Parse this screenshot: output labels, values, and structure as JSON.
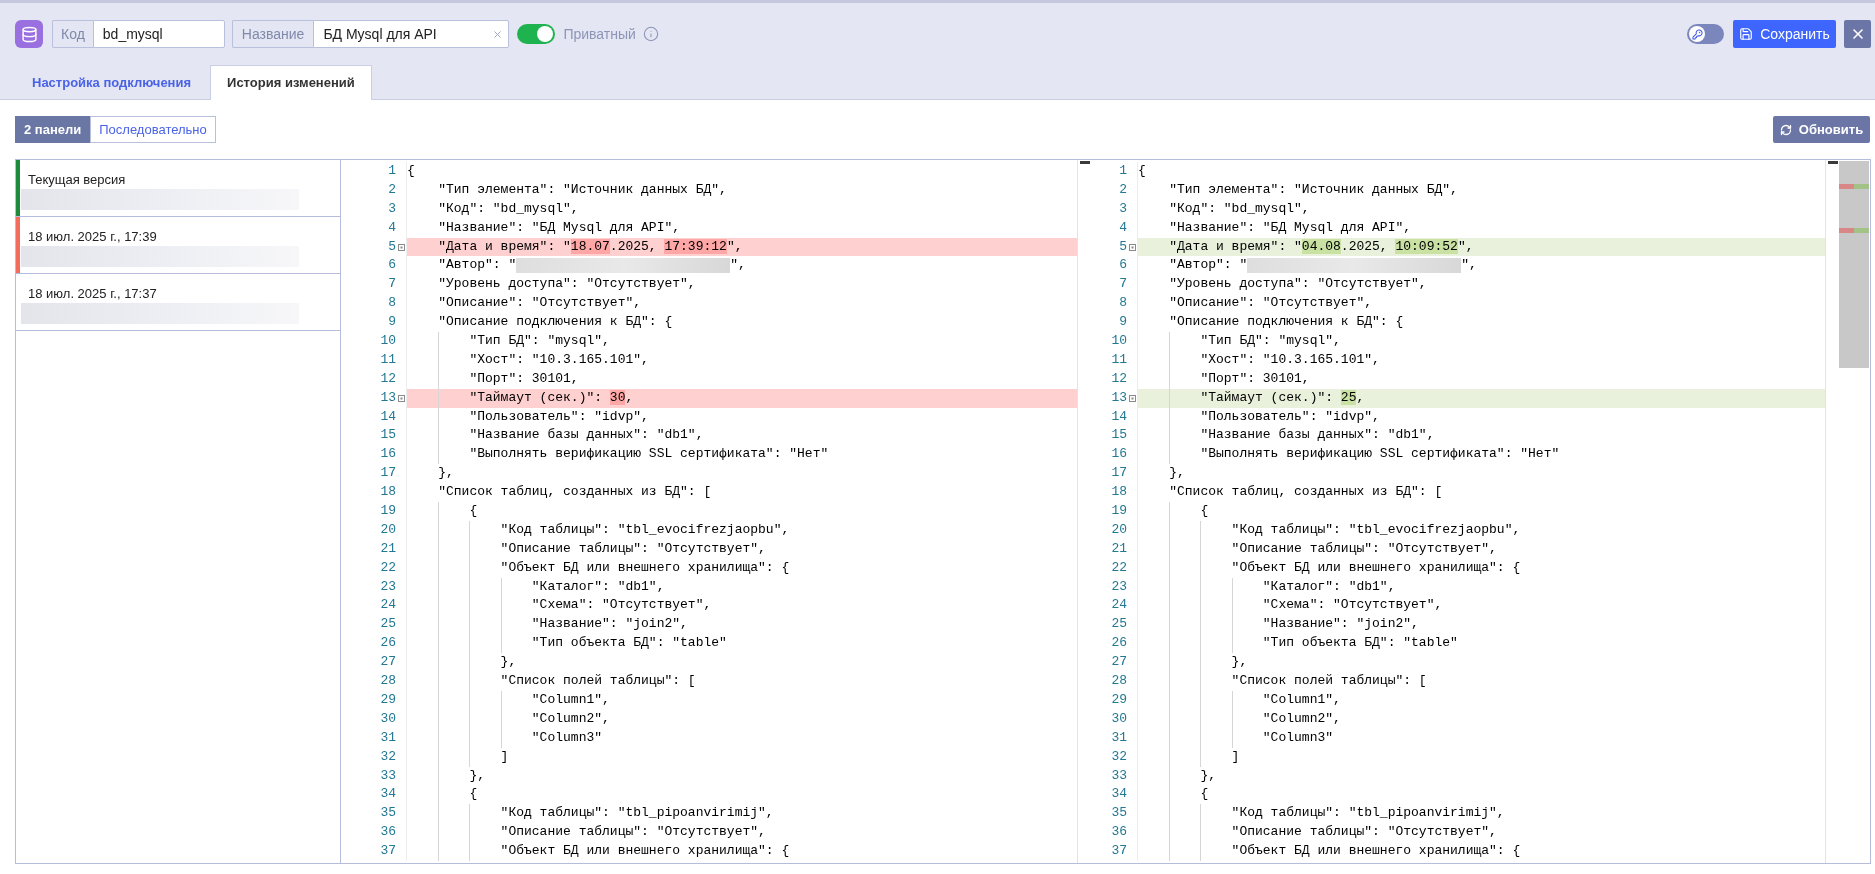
{
  "header": {
    "code_field": {
      "label": "Код",
      "value": "bd_mysql"
    },
    "name_field": {
      "label": "Название",
      "value": "БД Mysql для API"
    },
    "private_toggle": {
      "label": "Приватный",
      "on": true
    },
    "key_toggle": {
      "on": false
    },
    "save_button": "Сохранить"
  },
  "tabs": [
    {
      "label": "Настройка подключения",
      "selected": false
    },
    {
      "label": "История изменений",
      "selected": true
    }
  ],
  "toolbar": {
    "view_modes": [
      {
        "label": "2 панели",
        "selected": true
      },
      {
        "label": "Последовательно",
        "selected": false
      }
    ],
    "refresh_button": "Обновить"
  },
  "versions": [
    {
      "title": "Текущая версия",
      "color": "#1e8a3c"
    },
    {
      "title": "18 июл. 2025 г., 17:39",
      "color": "#f46c5c"
    },
    {
      "title": "18 июл. 2025 г., 17:37"
    }
  ],
  "diff": {
    "left": {
      "lines": [
        {
          "number": "1",
          "changed": false,
          "text": "{"
        },
        {
          "number": "2",
          "changed": false,
          "text": "    \"Тип элемента\": \"Источник данных БД\","
        },
        {
          "number": "3",
          "changed": false,
          "text": "    \"Код\": \"bd_mysql\","
        },
        {
          "number": "4",
          "changed": false,
          "text": "    \"Название\": \"БД Mysql для API\","
        },
        {
          "number": "5",
          "changed": true,
          "segments": [
            {
              "kind": "code",
              "text": "    \"Дата и время\": \""
            },
            {
              "kind": "diff",
              "text": "18.07"
            },
            {
              "kind": "code",
              "text": ".2025, "
            },
            {
              "kind": "diff",
              "text": "17:39:12"
            },
            {
              "kind": "code",
              "text": "\","
            }
          ]
        },
        {
          "number": "6",
          "changed": false,
          "segments": [
            {
              "kind": "code",
              "text": "    \"Автор\": \""
            },
            {
              "kind": "blurred"
            },
            {
              "kind": "code",
              "text": "\","
            }
          ]
        },
        {
          "number": "7",
          "changed": false,
          "text": "    \"Уровень доступа\": \"Отсутствует\","
        },
        {
          "number": "8",
          "changed": false,
          "text": "    \"Описание\": \"Отсутствует\","
        },
        {
          "number": "9",
          "changed": false,
          "text": "    \"Описание подключения к БД\": {"
        },
        {
          "number": "10",
          "changed": false,
          "text": "        \"Тип БД\": \"mysql\","
        },
        {
          "number": "11",
          "changed": false,
          "text": "        \"Хост\": \"10.3.165.101\","
        },
        {
          "number": "12",
          "changed": false,
          "text": "        \"Порт\": 30101,"
        },
        {
          "number": "13",
          "changed": true,
          "segments": [
            {
              "kind": "code",
              "text": "        \"Таймаут (сек.)\": "
            },
            {
              "kind": "diff",
              "text": "30"
            },
            {
              "kind": "code",
              "text": ","
            }
          ]
        },
        {
          "number": "14",
          "changed": false,
          "text": "        \"Пользователь\": \"idvp\","
        },
        {
          "number": "15",
          "changed": false,
          "text": "        \"Название базы данных\": \"db1\","
        },
        {
          "number": "16",
          "changed": false,
          "text": "        \"Выполнять верификацию SSL сертификата\": \"Нет\""
        },
        {
          "number": "17",
          "changed": false,
          "text": "    },"
        },
        {
          "number": "18",
          "changed": false,
          "text": "    \"Список таблиц, созданных из БД\": ["
        },
        {
          "number": "19",
          "changed": false,
          "text": "        {"
        },
        {
          "number": "20",
          "changed": false,
          "text": "            \"Код таблицы\": \"tbl_evocifrezjaopbu\","
        },
        {
          "number": "21",
          "changed": false,
          "text": "            \"Описание таблицы\": \"Отсутствует\","
        },
        {
          "number": "22",
          "changed": false,
          "text": "            \"Объект БД или внешнего хранилища\": {"
        },
        {
          "number": "23",
          "changed": false,
          "text": "                \"Каталог\": \"db1\","
        },
        {
          "number": "24",
          "changed": false,
          "text": "                \"Схема\": \"Отсутствует\","
        },
        {
          "number": "25",
          "changed": false,
          "text": "                \"Название\": \"join2\","
        },
        {
          "number": "26",
          "changed": false,
          "text": "                \"Тип объекта БД\": \"table\""
        },
        {
          "number": "27",
          "changed": false,
          "text": "            },"
        },
        {
          "number": "28",
          "changed": false,
          "text": "            \"Список полей таблицы\": ["
        },
        {
          "number": "29",
          "changed": false,
          "text": "                \"Column1\","
        },
        {
          "number": "30",
          "changed": false,
          "text": "                \"Column2\","
        },
        {
          "number": "31",
          "changed": false,
          "text": "                \"Column3\""
        },
        {
          "number": "32",
          "changed": false,
          "text": "            ]"
        },
        {
          "number": "33",
          "changed": false,
          "text": "        },"
        },
        {
          "number": "34",
          "changed": false,
          "text": "        {"
        },
        {
          "number": "35",
          "changed": false,
          "text": "            \"Код таблицы\": \"tbl_pipoanvirimij\","
        },
        {
          "number": "36",
          "changed": false,
          "text": "            \"Описание таблицы\": \"Отсутствует\","
        },
        {
          "number": "37",
          "changed": false,
          "text": "            \"Объект БД или внешнего хранилища\": {"
        }
      ]
    },
    "right": {
      "lines": [
        {
          "number": "1",
          "changed": false,
          "text": "{"
        },
        {
          "number": "2",
          "changed": false,
          "text": "    \"Тип элемента\": \"Источник данных БД\","
        },
        {
          "number": "3",
          "changed": false,
          "text": "    \"Код\": \"bd_mysql\","
        },
        {
          "number": "4",
          "changed": false,
          "text": "    \"Название\": \"БД Mysql для API\","
        },
        {
          "number": "5",
          "changed": true,
          "segments": [
            {
              "kind": "code",
              "text": "    \"Дата и время\": \""
            },
            {
              "kind": "diff",
              "text": "04.08"
            },
            {
              "kind": "code",
              "text": ".2025, "
            },
            {
              "kind": "diff",
              "text": "10:09:52"
            },
            {
              "kind": "code",
              "text": "\","
            }
          ]
        },
        {
          "number": "6",
          "changed": false,
          "segments": [
            {
              "kind": "code",
              "text": "    \"Автор\": \""
            },
            {
              "kind": "blurred"
            },
            {
              "kind": "code",
              "text": "\","
            }
          ]
        },
        {
          "number": "7",
          "changed": false,
          "text": "    \"Уровень доступа\": \"Отсутствует\","
        },
        {
          "number": "8",
          "changed": false,
          "text": "    \"Описание\": \"Отсутствует\","
        },
        {
          "number": "9",
          "changed": false,
          "text": "    \"Описание подключения к БД\": {"
        },
        {
          "number": "10",
          "changed": false,
          "text": "        \"Тип БД\": \"mysql\","
        },
        {
          "number": "11",
          "changed": false,
          "text": "        \"Хост\": \"10.3.165.101\","
        },
        {
          "number": "12",
          "changed": false,
          "text": "        \"Порт\": 30101,"
        },
        {
          "number": "13",
          "changed": true,
          "segments": [
            {
              "kind": "code",
              "text": "        \"Таймаут (сек.)\": "
            },
            {
              "kind": "diff",
              "text": "25"
            },
            {
              "kind": "code",
              "text": ","
            }
          ]
        },
        {
          "number": "14",
          "changed": false,
          "text": "        \"Пользователь\": \"idvp\","
        },
        {
          "number": "15",
          "changed": false,
          "text": "        \"Название базы данных\": \"db1\","
        },
        {
          "number": "16",
          "changed": false,
          "text": "        \"Выполнять верификацию SSL сертификата\": \"Нет\""
        },
        {
          "number": "17",
          "changed": false,
          "text": "    },"
        },
        {
          "number": "18",
          "changed": false,
          "text": "    \"Список таблиц, созданных из БД\": ["
        },
        {
          "number": "19",
          "changed": false,
          "text": "        {"
        },
        {
          "number": "20",
          "changed": false,
          "text": "            \"Код таблицы\": \"tbl_evocifrezjaopbu\","
        },
        {
          "number": "21",
          "changed": false,
          "text": "            \"Описание таблицы\": \"Отсутствует\","
        },
        {
          "number": "22",
          "changed": false,
          "text": "            \"Объект БД или внешнего хранилища\": {"
        },
        {
          "number": "23",
          "changed": false,
          "text": "                \"Каталог\": \"db1\","
        },
        {
          "number": "24",
          "changed": false,
          "text": "                \"Схема\": \"Отсутствует\","
        },
        {
          "number": "25",
          "changed": false,
          "text": "                \"Название\": \"join2\","
        },
        {
          "number": "26",
          "changed": false,
          "text": "                \"Тип объекта БД\": \"table\""
        },
        {
          "number": "27",
          "changed": false,
          "text": "            },"
        },
        {
          "number": "28",
          "changed": false,
          "text": "            \"Список полей таблицы\": ["
        },
        {
          "number": "29",
          "changed": false,
          "text": "                \"Column1\","
        },
        {
          "number": "30",
          "changed": false,
          "text": "                \"Column2\","
        },
        {
          "number": "31",
          "changed": false,
          "text": "                \"Column3\""
        },
        {
          "number": "32",
          "changed": false,
          "text": "            ]"
        },
        {
          "number": "33",
          "changed": false,
          "text": "        },"
        },
        {
          "number": "34",
          "changed": false,
          "text": "        {"
        },
        {
          "number": "35",
          "changed": false,
          "text": "            \"Код таблицы\": \"tbl_pipoanvirimij\","
        },
        {
          "number": "36",
          "changed": false,
          "text": "            \"Описание таблицы\": \"Отсутствует\","
        },
        {
          "number": "37",
          "changed": false,
          "text": "            \"Объект БД или внешнего хранилища\": {"
        }
      ]
    }
  }
}
